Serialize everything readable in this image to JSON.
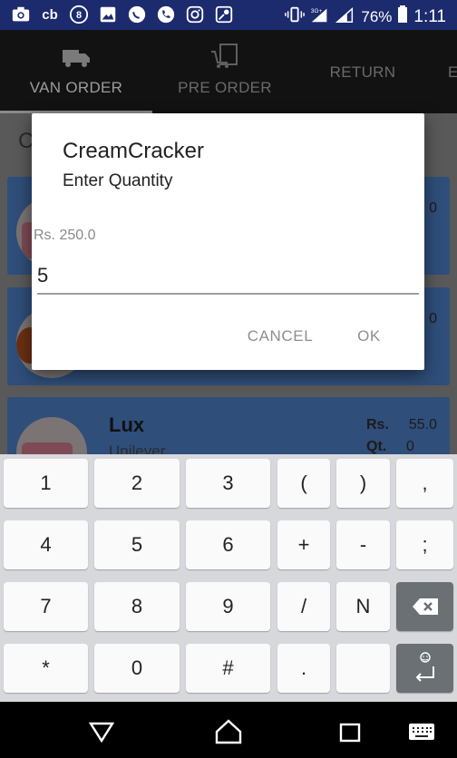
{
  "status_bar": {
    "icons": [
      "camera-icon",
      "cb-icon",
      "circle-8-icon",
      "image-icon",
      "whatsapp-icon",
      "phone-icon",
      "instagram-icon",
      "maps-icon"
    ],
    "cb_text": "cb",
    "circle_text": "8",
    "network_label": "3G+",
    "battery": "76%",
    "time": "1:11"
  },
  "tabs": [
    {
      "label": "VAN ORDER",
      "icon": "truck-icon"
    },
    {
      "label": "PRE ORDER",
      "icon": "cart-icon"
    },
    {
      "label": "RETURN"
    },
    {
      "label": "E"
    }
  ],
  "background": {
    "title_partial": "C",
    "card1_value": "0",
    "card2_value": "0",
    "card3": {
      "name": "Lux",
      "brand": "Unilever",
      "rs_label": "Rs.",
      "rs_value": "55.0",
      "qt_label": "Qt.",
      "qt_value": "0"
    }
  },
  "dialog": {
    "title": "CreamCracker",
    "message": "Enter Quantity",
    "hint": "Rs. 250.0",
    "input_value": "5",
    "cancel_label": "CANCEL",
    "ok_label": "OK"
  },
  "keyboard": {
    "rows": [
      [
        "1",
        "2",
        "3",
        "(",
        ")",
        ","
      ],
      [
        "4",
        "5",
        "6",
        "+",
        "-",
        ";"
      ],
      [
        "7",
        "8",
        "9",
        "/",
        "N",
        ""
      ],
      [
        "*",
        "0",
        "#",
        ".",
        "",
        ""
      ]
    ]
  },
  "colors": {
    "status_bar": "#1c2a6e",
    "card": "#2f4e7a",
    "dialog_bg": "#ffffff",
    "keyboard_bg": "#d6d8db"
  }
}
